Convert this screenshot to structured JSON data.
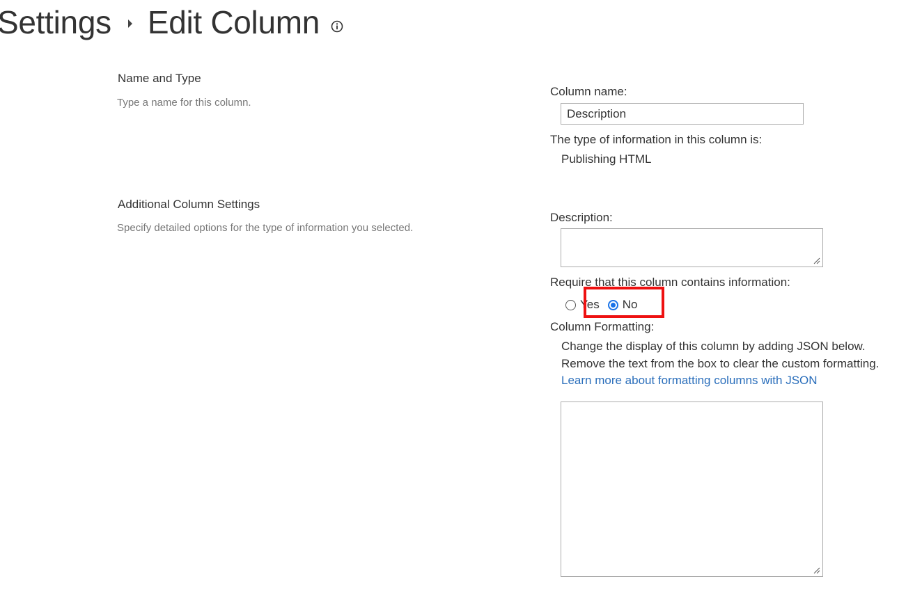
{
  "header": {
    "crumb_parent": "Settings",
    "crumb_current": "Edit Column",
    "info_icon": "info-icon"
  },
  "sections": {
    "name_type": {
      "title": "Name and Type",
      "description": "Type a name for this column."
    },
    "additional": {
      "title": "Additional Column Settings",
      "description": "Specify detailed options for the type of information you selected."
    }
  },
  "form": {
    "column_name_label": "Column name:",
    "column_name_value": "Description",
    "type_info_label": "The type of information in this column is:",
    "type_info_value": "Publishing HTML",
    "description_label": "Description:",
    "description_value": "",
    "require_label": "Require that this column contains information:",
    "require_options": {
      "yes": "Yes",
      "no": "No",
      "selected": "No"
    },
    "formatting_label": "Column Formatting:",
    "formatting_help_line1": "Change the display of this column by adding JSON below.",
    "formatting_help_line2": "Remove the text from the box to clear the custom formatting.",
    "formatting_link": "Learn more about formatting columns with JSON",
    "formatting_value": ""
  },
  "colors": {
    "accent": "#1a73e8",
    "link": "#2a6ebb",
    "highlight": "#ee1111"
  }
}
